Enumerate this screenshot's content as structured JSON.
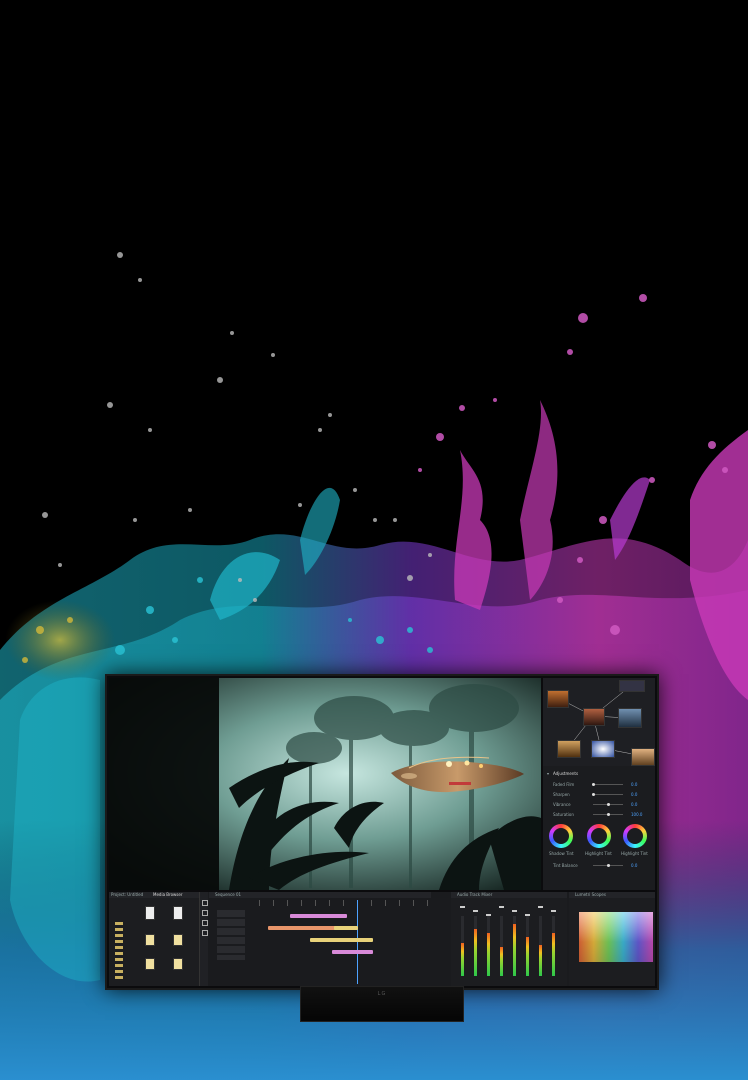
{
  "colors": {
    "background": "#000000",
    "splash_cyan": "#1fb5c9",
    "splash_magenta": "#c93ab8",
    "splash_purple": "#7a3bd1",
    "splash_gold": "#c9b02e",
    "panel_bg": "#1b1c1f",
    "accent_blue": "#4ea3ff",
    "clip_pink": "#d88ad8",
    "clip_orange": "#e8956a",
    "clip_yellow": "#e8d27a"
  },
  "monitor": {
    "brand_logo": "LG"
  },
  "editor": {
    "adjustments": {
      "header": "Adjustments",
      "rows": [
        {
          "label": "Faded Film",
          "value": 0.0
        },
        {
          "label": "Sharpen",
          "value": 0.0
        },
        {
          "label": "Vibrance",
          "value": 0.0
        },
        {
          "label": "Saturation",
          "value": 100.0
        }
      ],
      "wheels": [
        {
          "label": "Shadow Tint"
        },
        {
          "label": "Highlight Tint"
        },
        {
          "label": "Highlight Tint"
        }
      ],
      "tint_balance": {
        "label": "Tint Balance",
        "value": 0.0
      }
    },
    "panels": {
      "project": "Project: Untitled",
      "media_browser": "Media Browser",
      "timeline": "Sequence 01",
      "audio_mixer": "Audio Track Mixer",
      "lumetri_scopes": "Lumetri Scopes"
    },
    "timeline_clips": [
      {
        "track": 0,
        "start": 0.18,
        "end": 0.52,
        "color": "clip_pink"
      },
      {
        "track": 1,
        "start": 0.05,
        "end": 0.45,
        "color": "clip_orange"
      },
      {
        "track": 1,
        "start": 0.44,
        "end": 0.58,
        "color": "clip_yellow"
      },
      {
        "track": 2,
        "start": 0.3,
        "end": 0.67,
        "color": "clip_yellow"
      },
      {
        "track": 3,
        "start": 0.43,
        "end": 0.67,
        "color": "clip_pink"
      }
    ],
    "audio_levels": [
      0.55,
      0.78,
      0.72,
      0.48,
      0.86,
      0.65,
      0.52,
      0.72
    ]
  }
}
